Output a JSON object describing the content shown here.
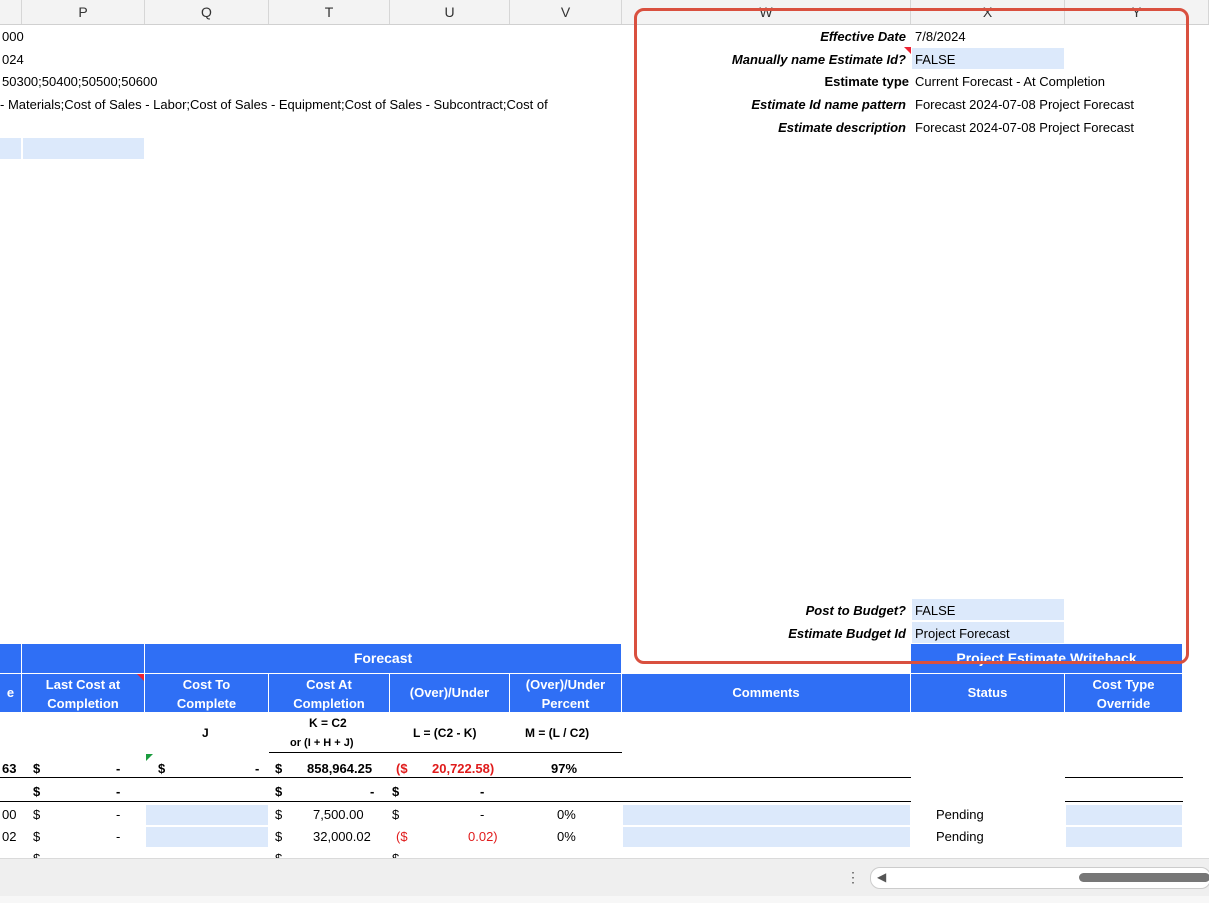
{
  "columns": [
    "P",
    "Q",
    "T",
    "U",
    "V",
    "W",
    "X",
    "Y"
  ],
  "left_text": {
    "row1": "000",
    "row2": "024",
    "row3": "50300;50400;50500;50600",
    "row4": " - Materials;Cost of Sales - Labor;Cost of Sales - Equipment;Cost of Sales - Subcontract;Cost of"
  },
  "params": {
    "effective_date_label": "Effective Date",
    "effective_date_value": "7/8/2024",
    "manual_name_label": "Manually name Estimate Id?",
    "manual_name_value": "FALSE",
    "estimate_type_label": "Estimate type",
    "estimate_type_value": "Current Forecast - At Completion",
    "id_pattern_label": "Estimate Id name pattern",
    "id_pattern_value": "Forecast 2024-07-08 Project Forecast",
    "description_label": "Estimate description",
    "description_value": "Forecast 2024-07-08 Project Forecast",
    "post_budget_label": "Post to Budget?",
    "post_budget_value": "FALSE",
    "budget_id_label": "Estimate Budget Id",
    "budget_id_value": "Project Forecast"
  },
  "table": {
    "forecast_title": "Forecast",
    "writeback_title": "Project Estimate Writeback",
    "headers": {
      "left_partial": "e",
      "last_cost_1": "Last Cost at",
      "last_cost_2": "Completion",
      "cost_to_1": "Cost To",
      "cost_to_2": "Complete",
      "cost_at_1": "Cost At",
      "cost_at_2": "Completion",
      "over_under": "(Over)/Under",
      "over_under_pct_1": "(Over)/Under",
      "over_under_pct_2": "Percent",
      "comments": "Comments",
      "status": "Status",
      "cost_type_1": "Cost Type",
      "cost_type_2": "Override"
    },
    "formulas": {
      "j": "J",
      "k1": "K = C2",
      "k2": "or (I + H + J)",
      "l": "L = (C2 - K)",
      "m": "M = (L / C2)"
    },
    "total_row": {
      "left": "63",
      "dollar1": "$",
      "last_cost": "-",
      "dollar2": "$",
      "cost_to": "-",
      "dollar3": "$",
      "cost_at": "858,964.25",
      "paren": "($",
      "over_under": "20,722.58)",
      "pct": "97%"
    },
    "row_a": {
      "dollar1": "$",
      "last_cost": "-",
      "dollar3": "$",
      "cost_at": "-",
      "dollar4": "$",
      "over_under": "-"
    },
    "row_b": {
      "left": "00",
      "dollar1": "$",
      "last_cost": "-",
      "dollar3": "$",
      "cost_at": "7,500.00",
      "dollar4": "$",
      "over_under": "-",
      "pct": "0%",
      "status": "Pending"
    },
    "row_c": {
      "left": "02",
      "dollar1": "$",
      "last_cost": "-",
      "dollar3": "$",
      "cost_at": "32,000.02",
      "paren": "($",
      "over_under": "0.02)",
      "pct": "0%",
      "status": "Pending"
    },
    "row_d": {
      "dollar1": "$",
      "dollar3": "$",
      "dollar4": "$"
    }
  },
  "colors": {
    "header_blue": "#2f6ff5",
    "input_blue": "#dce9fb",
    "highlight_red": "#d9503f"
  }
}
